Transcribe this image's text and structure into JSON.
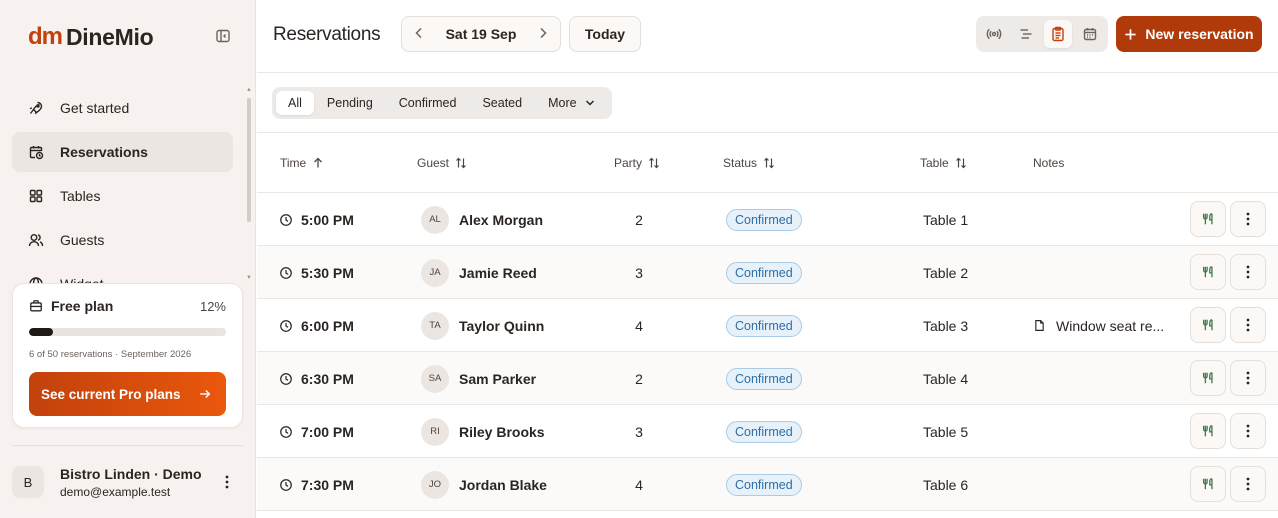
{
  "brand": {
    "mark": "dm",
    "name": "DineMio",
    "accent": "#c2410c"
  },
  "sidebar": {
    "items": [
      {
        "label": "Get started",
        "icon": "rocket-icon",
        "active": false
      },
      {
        "label": "Reservations",
        "icon": "calendar-clock-icon",
        "active": true
      },
      {
        "label": "Tables",
        "icon": "grid-icon",
        "active": false
      },
      {
        "label": "Guests",
        "icon": "users-icon",
        "active": false
      },
      {
        "label": "Widget",
        "icon": "globe-icon",
        "active": false
      }
    ],
    "plan": {
      "title": "Free plan",
      "percent_label": "12%",
      "usage_fraction": 0.12,
      "subtext": "6 of 50 reservations · September 2026",
      "cta": "See current Pro plans"
    },
    "account": {
      "initial": "B",
      "name": "Bistro Linden · Demo",
      "email": "demo@example.test"
    }
  },
  "header": {
    "title": "Reservations",
    "date": "Sat 19 Sep",
    "today_label": "Today",
    "views": [
      "live-icon",
      "timeline-icon",
      "list-icon",
      "calendar-icon"
    ],
    "active_view": "list-icon",
    "new_label": "New reservation"
  },
  "filters": {
    "tabs": [
      "All",
      "Pending",
      "Confirmed",
      "Seated",
      "More"
    ],
    "active": "All"
  },
  "table": {
    "columns": [
      "Time",
      "Guest",
      "Party",
      "Status",
      "Table",
      "Notes"
    ],
    "rows": [
      {
        "time": "5:00 PM",
        "initials": "AL",
        "guest": "Alex Morgan",
        "party": "2",
        "status": "Confirmed",
        "table": "Table 1",
        "notes": ""
      },
      {
        "time": "5:30 PM",
        "initials": "JA",
        "guest": "Jamie Reed",
        "party": "3",
        "status": "Confirmed",
        "table": "Table 2",
        "notes": ""
      },
      {
        "time": "6:00 PM",
        "initials": "TA",
        "guest": "Taylor Quinn",
        "party": "4",
        "status": "Confirmed",
        "table": "Table 3",
        "notes": "Window seat re..."
      },
      {
        "time": "6:30 PM",
        "initials": "SA",
        "guest": "Sam Parker",
        "party": "2",
        "status": "Confirmed",
        "table": "Table 4",
        "notes": ""
      },
      {
        "time": "7:00 PM",
        "initials": "RI",
        "guest": "Riley Brooks",
        "party": "3",
        "status": "Confirmed",
        "table": "Table 5",
        "notes": ""
      },
      {
        "time": "7:30 PM",
        "initials": "JO",
        "guest": "Jordan Blake",
        "party": "4",
        "status": "Confirmed",
        "table": "Table 6",
        "notes": ""
      }
    ]
  }
}
